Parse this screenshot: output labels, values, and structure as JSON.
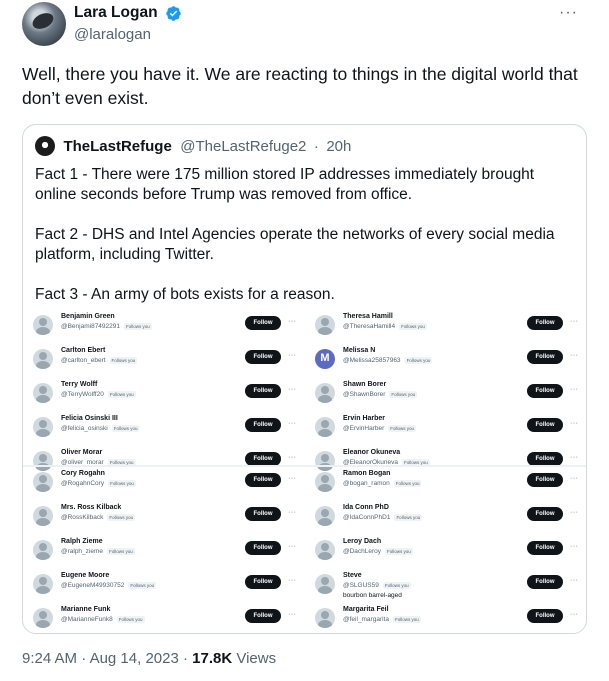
{
  "author": {
    "display_name": "Lara Logan",
    "handle": "@laralogan",
    "verified_color": "#1d9bf0",
    "more_icon": "more-icon"
  },
  "tweet": {
    "text": "Well, there you have it. We are reacting to things in the digital world that don’t even exist."
  },
  "quote": {
    "display_name": "TheLastRefuge",
    "handle": "@TheLastRefuge2",
    "separator": "·",
    "time": "20h",
    "paragraphs": [
      "Fact 1 - There were 175 million stored IP addresses immediately brought online seconds before Trump was removed from office.",
      "Fact 2 - DHS and Intel Agencies operate the networks of every social media platform, including Twitter.",
      "Fact 3 - An army of bots exists for a reason."
    ],
    "screenshot": {
      "follow_label": "Follow",
      "follows_you_label": "Follows you",
      "more_label": "···",
      "left_column": [
        {
          "name": "Benjamin Green",
          "handle": "@Benjami87492291",
          "follows_you": true
        },
        {
          "name": "Carlton Ebert",
          "handle": "@carlton_ebert",
          "follows_you": true
        },
        {
          "name": "Terry Wolff",
          "handle": "@TerryWolff20",
          "follows_you": true
        },
        {
          "name": "Felicia Osinski III",
          "handle": "@felicia_osinski",
          "follows_you": true
        },
        {
          "name": "Oliver Morar",
          "handle": "@oliver_morar",
          "follows_you": true
        },
        {
          "name": "Cory Rogahn",
          "handle": "@RogahnCory",
          "follows_you": true
        },
        {
          "name": "Mrs. Ross Kilback",
          "handle": "@RossKilback",
          "follows_you": true
        },
        {
          "name": "Ralph Zieme",
          "handle": "@ralph_zieme",
          "follows_you": true
        },
        {
          "name": "Eugene Moore",
          "handle": "@EugeneM49930752",
          "follows_you": true
        },
        {
          "name": "Marianne Funk",
          "handle": "@MarianneFunk8",
          "follows_you": true
        }
      ],
      "right_column": [
        {
          "name": "Theresa Hamill",
          "handle": "@TheresaHamill4",
          "follows_you": true
        },
        {
          "name": "Melissa N",
          "handle": "@Melissa25857963",
          "follows_you": true,
          "avatar_letter": "M"
        },
        {
          "name": "Shawn Borer",
          "handle": "@ShawnBorer",
          "follows_you": true
        },
        {
          "name": "Ervin Harber",
          "handle": "@ErvinHarber",
          "follows_you": true
        },
        {
          "name": "Eleanor Okuneva",
          "handle": "@EleanorOkuneva",
          "follows_you": true
        },
        {
          "name": "Ramon Bogan",
          "handle": "@bogan_ramon",
          "follows_you": true
        },
        {
          "name": "Ida Conn PhD",
          "handle": "@IdaConnPhD1",
          "follows_you": true
        },
        {
          "name": "Leroy Dach",
          "handle": "@DachLeroy",
          "follows_you": true
        },
        {
          "name": "Steve",
          "handle": "@SLGUS59",
          "follows_you": true,
          "bio": "bourbon barrel-aged"
        },
        {
          "name": "Margarita Feil",
          "handle": "@feil_margarita",
          "follows_you": true
        }
      ]
    }
  },
  "meta": {
    "time": "9:24 AM",
    "separator": "·",
    "date": "Aug 14, 2023",
    "separator2": "·",
    "views_count": "17.8K",
    "views_label": "Views"
  }
}
